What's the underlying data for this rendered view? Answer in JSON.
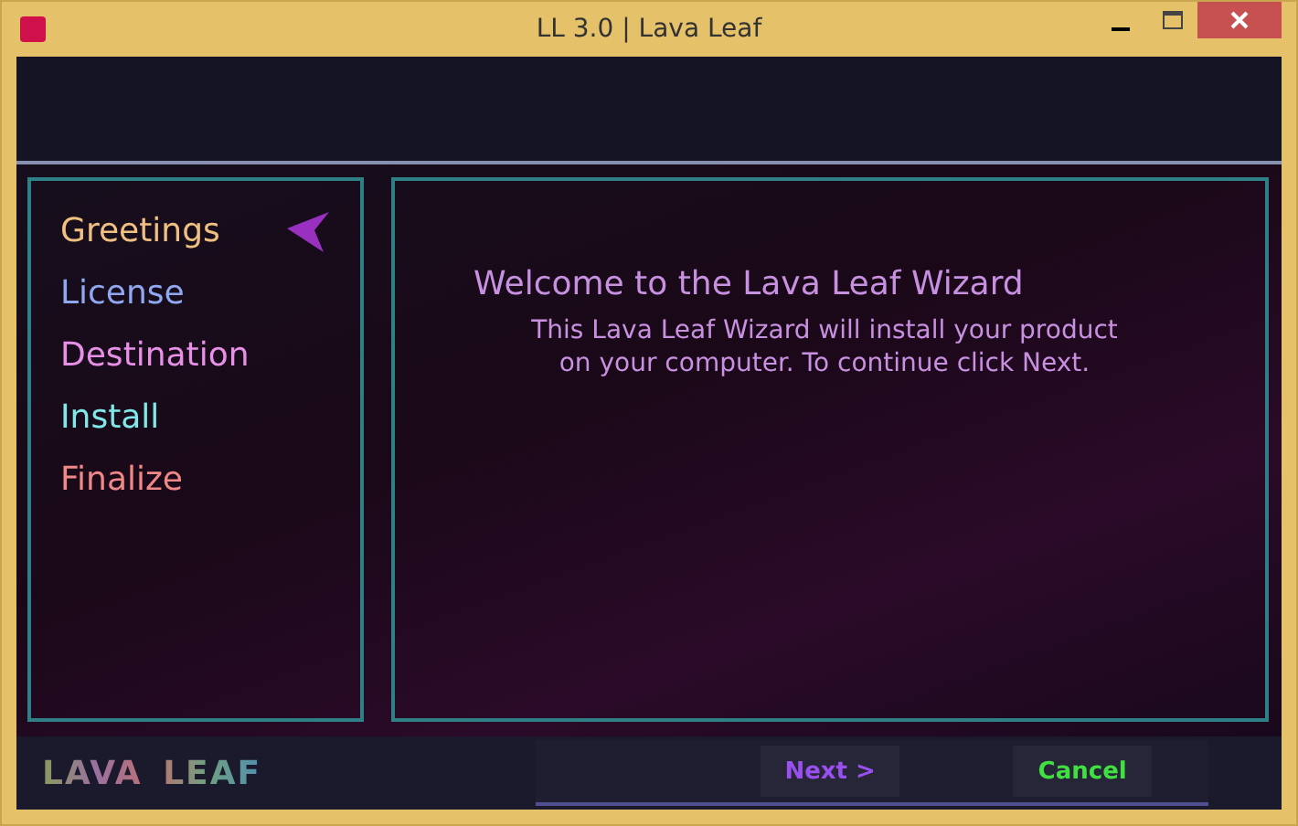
{
  "window": {
    "title": "LL 3.0 | Lava Leaf"
  },
  "steps": [
    {
      "label": "Greetings",
      "color": "#f0c080",
      "selected": true
    },
    {
      "label": "License",
      "color": "#8fa8f0",
      "selected": false
    },
    {
      "label": "Destination",
      "color": "#e890e8",
      "selected": false
    },
    {
      "label": "Install",
      "color": "#80e8e8",
      "selected": false
    },
    {
      "label": "Finalize",
      "color": "#f08888",
      "selected": false
    }
  ],
  "content": {
    "heading": "Welcome to the Lava Leaf Wizard",
    "body": "This Lava Leaf Wizard will install your product on your computer. To continue click Next."
  },
  "footer": {
    "logo": "LAVA LEAF",
    "buttons": [
      {
        "label": "Next >",
        "kind": "next"
      },
      {
        "label": "Cancel",
        "kind": "cancel"
      }
    ]
  }
}
